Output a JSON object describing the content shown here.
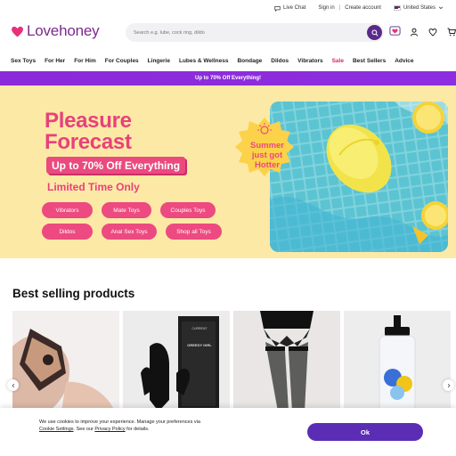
{
  "utility": {
    "live_chat": "Live Chat",
    "sign_in": "Sign in",
    "separator": "|",
    "create_account": "Create account",
    "region": "United States"
  },
  "header": {
    "logo_text": "Lovehoney",
    "search_placeholder": "Search e.g. lube, cock ring, dildo"
  },
  "nav": {
    "items": [
      "Sex Toys",
      "For Her",
      "For Him",
      "For Couples",
      "Lingerie",
      "Lubes & Wellness",
      "Bondage",
      "Dildos",
      "Vibrators",
      "Sale",
      "Best Sellers",
      "Advice"
    ]
  },
  "promo": {
    "text": "Up to 70% Off Everything!"
  },
  "hero": {
    "title_line1": "Pleasure",
    "title_line2": "Forecast",
    "offer": "Up to 70% Off Everything",
    "limited": "Limited Time Only",
    "badge_text": [
      "Summer",
      "just got",
      "Hotter"
    ],
    "pills": [
      "Vibrators",
      "Mate Toys",
      "Couples Toys",
      "Dildos",
      "Anal Sex Toys",
      "Shop all Toys"
    ]
  },
  "best_selling": {
    "title": "Best selling products",
    "product_box_text": [
      "CURRENT",
      "GREEDY GIRL"
    ]
  },
  "cookie": {
    "text1": "We use cookies to improve your experience. Manage your preferences via",
    "link1": "Cookie Settings",
    "text2": ". See our ",
    "link2": "Privacy Policy",
    "text3": " for details.",
    "ok": "Ok"
  },
  "colors": {
    "brand_purple": "#7c2a8e",
    "promo_purple": "#8b2ad8",
    "hero_pink": "#e8417a",
    "hero_bg": "#fde9a6",
    "ok_button": "#5b2db5",
    "sale_red": "#e0245e"
  }
}
